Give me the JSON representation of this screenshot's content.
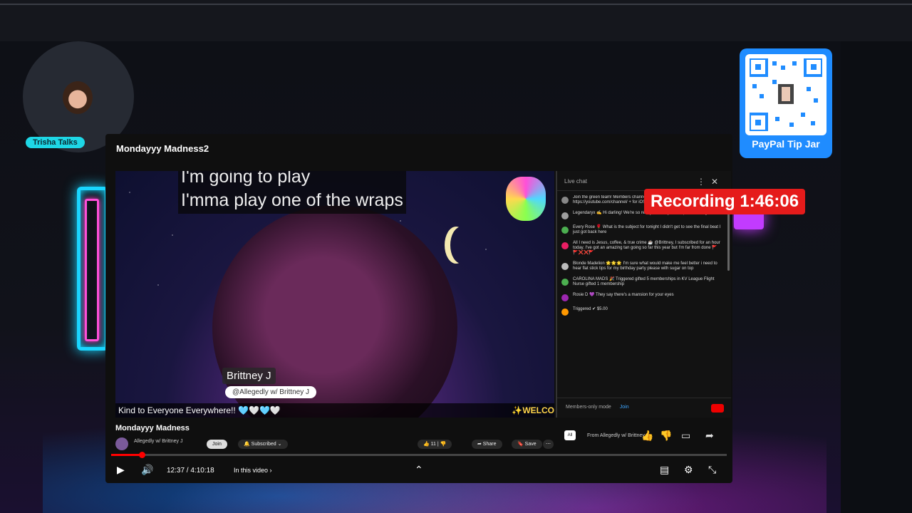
{
  "host": {
    "badge": "Trisha Talks"
  },
  "tip": {
    "label": "PayPal Tip Jar"
  },
  "player": {
    "title": "Mondayyy Madness2",
    "captions": [
      "I'm going to play",
      "I'mma play one of the wraps"
    ],
    "guest_name": "Brittney J",
    "guest_handle": "@Allegedly w/ Brittney J",
    "ticker": "Kind to Everyone Everywhere!! 🩵🤍🩵🤍",
    "ticker_right": "✨WELCO"
  },
  "recording": {
    "label": "Recording 1:46:06"
  },
  "chat": {
    "header": "Live chat",
    "messages": [
      {
        "text": "Join the green team! Members channel link — for android https://youtube.com/channel/ + for iOS"
      },
      {
        "text": "Legendaryx ✍ Hi darling! We're so ready to hear your responses tonight"
      },
      {
        "text": "Every Rose 🌹 What is the subject for tonight I didn't get to see the final beat I just got back here"
      },
      {
        "text": "All I need is Jesus, coffee, & true crime ☕ @Brittney, I subscribed for an hour today. I've got an amazing tan going so far this year but I'm far from done 🚩🚩❌❌🚩"
      },
      {
        "text": "Blonde Madelion 🌟🌟🌟 I'm sure what would make me feel better i need to hear flat stick tips for my birthday party please with sugar on top"
      },
      {
        "text": "CAROLINA MADS 🎉 Triggered gifted 5 memberships in KV League Flight Nurse gifted 1 membership"
      },
      {
        "text": "Rosie D 💜 They say there's a mansion for your eyes"
      },
      {
        "text": "Triggered ✔ $5.00"
      }
    ],
    "footer": "Members-only mode",
    "join": "Join",
    "input_all": "All",
    "input_from": "From Allegedly w/ Brittney J"
  },
  "below": {
    "title": "Mondayyy Madness",
    "channel": "Allegedly w/ Brittney J",
    "join": "Join",
    "subscribed": "🔔 Subscribed ⌄",
    "likes": "👍 11 | 👎",
    "share": "➦ Share",
    "save": "🔖 Save",
    "more": "⋯"
  },
  "controls": {
    "time": "12:37 / 4:10:18",
    "chapter": "In this video ›",
    "progress": 0.05
  }
}
